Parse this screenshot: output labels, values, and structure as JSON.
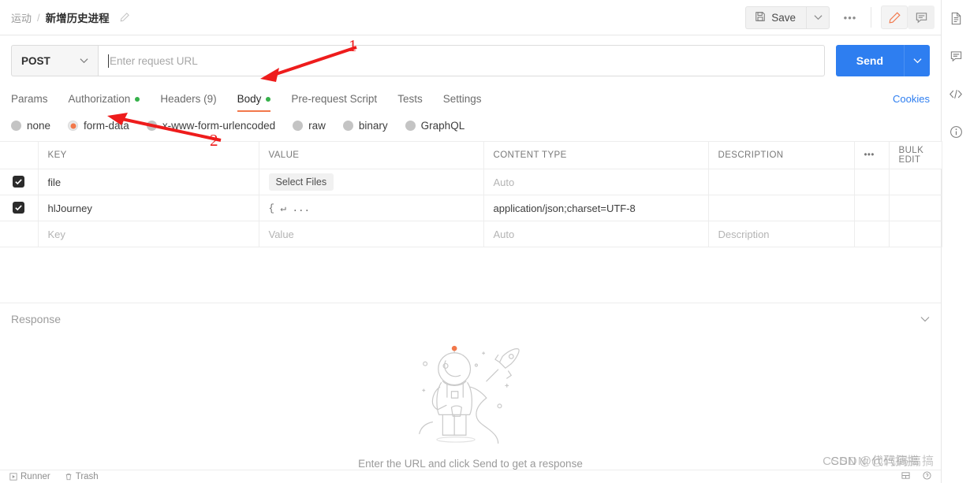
{
  "topbar": {
    "breadcrumb_parent": "运动",
    "breadcrumb_sep": "/",
    "breadcrumb_current": "新增历史进程",
    "save_label": "Save",
    "more_label": "•••"
  },
  "request": {
    "method": "POST",
    "url_value": "",
    "url_placeholder": "Enter request URL",
    "send_label": "Send"
  },
  "tabs": {
    "cookies_label": "Cookies",
    "items": [
      {
        "label": "Params",
        "dot": false,
        "active": false
      },
      {
        "label": "Authorization",
        "dot": true,
        "active": false
      },
      {
        "label": "Headers (9)",
        "dot": false,
        "active": false
      },
      {
        "label": "Body",
        "dot": true,
        "active": true
      },
      {
        "label": "Pre-request Script",
        "dot": false,
        "active": false
      },
      {
        "label": "Tests",
        "dot": false,
        "active": false
      },
      {
        "label": "Settings",
        "dot": false,
        "active": false
      }
    ]
  },
  "body_types": [
    {
      "label": "none",
      "selected": false
    },
    {
      "label": "form-data",
      "selected": true
    },
    {
      "label": "x-www-form-urlencoded",
      "selected": false
    },
    {
      "label": "raw",
      "selected": false
    },
    {
      "label": "binary",
      "selected": false
    },
    {
      "label": "GraphQL",
      "selected": false
    }
  ],
  "table": {
    "headers": {
      "key": "KEY",
      "value": "VALUE",
      "content_type": "CONTENT TYPE",
      "description": "DESCRIPTION",
      "dots": "•••",
      "bulk_edit": "Bulk Edit"
    },
    "rows": [
      {
        "checked": true,
        "key": "file",
        "value": "Select Files",
        "value_kind": "button",
        "content_type": "Auto",
        "content_type_kind": "placeholder",
        "description": ""
      },
      {
        "checked": true,
        "key": "hlJourney",
        "value": "{ ↵ ...",
        "value_kind": "json",
        "content_type": "application/json;charset=UTF-8",
        "content_type_kind": "text",
        "description": ""
      },
      {
        "checked": false,
        "key": "Key",
        "key_kind": "placeholder",
        "value": "Value",
        "value_kind": "placeholder",
        "content_type": "Auto",
        "content_type_kind": "placeholder",
        "description": "Description",
        "description_kind": "placeholder"
      }
    ]
  },
  "response": {
    "title": "Response",
    "empty_message": "Enter the URL and click Send to get a response"
  },
  "rail": {
    "items": [
      {
        "name": "documentation-icon"
      },
      {
        "name": "comment-icon"
      },
      {
        "name": "code-icon"
      },
      {
        "name": "info-icon"
      }
    ]
  },
  "statusbar": {
    "runner_label": "Runner",
    "trash_label": "Trash"
  },
  "annotations": [
    {
      "number": "1"
    },
    {
      "number": "2"
    }
  ],
  "watermark": {
    "text_back": "CSDN @代码搞搞",
    "text_front": "CSDN @代码搞搞"
  },
  "colors": {
    "accent_orange": "#f2784b",
    "send_blue": "#2e7ef0",
    "dot_green": "#35b14a",
    "annotation_red": "#ee1c1c"
  }
}
